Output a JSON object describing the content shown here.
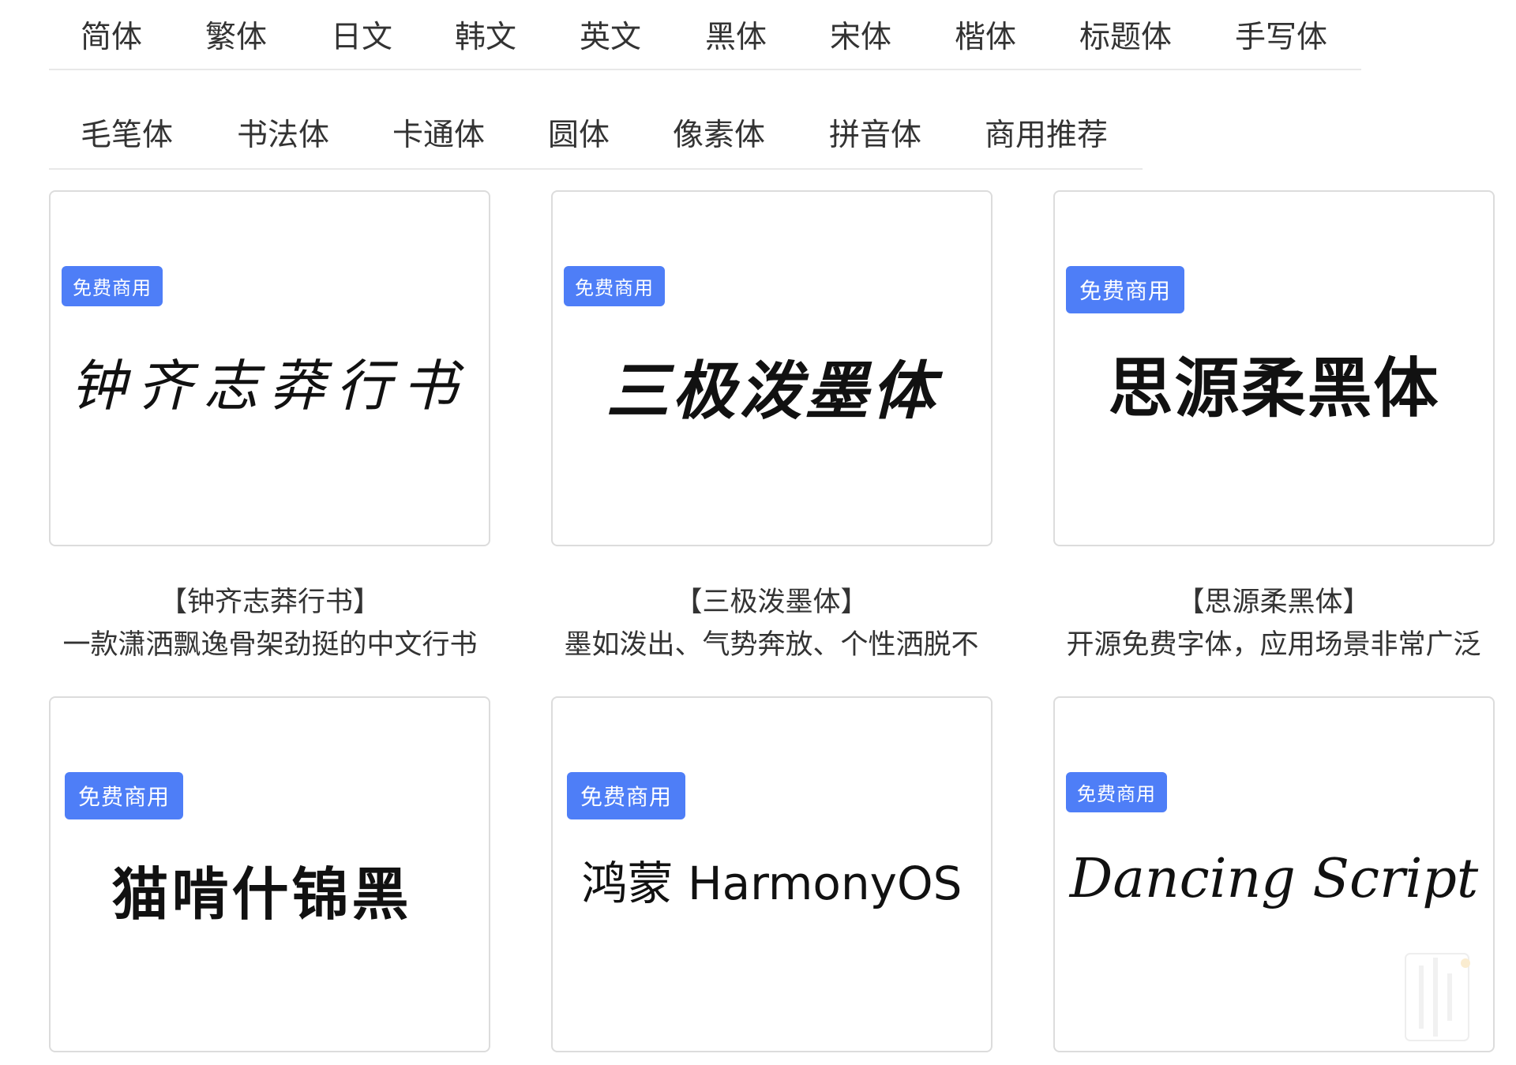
{
  "nav": {
    "row1": [
      "简体",
      "繁体",
      "日文",
      "韩文",
      "英文",
      "黑体",
      "宋体",
      "楷体",
      "标题体",
      "手写体"
    ],
    "row2": [
      "毛笔体",
      "书法体",
      "卡通体",
      "圆体",
      "像素体",
      "拼音体",
      "商用推荐"
    ]
  },
  "cards": [
    {
      "badge": "免费商用",
      "preview": "钟齐志莽行书",
      "title": "【钟齐志莽行书】",
      "description": "一款潇洒飘逸骨架劲挺的中文行书"
    },
    {
      "badge": "免费商用",
      "preview": "三极泼墨体",
      "title": "【三极泼墨体】",
      "description": "墨如泼出、气势奔放、个性洒脱不"
    },
    {
      "badge": "免费商用",
      "preview": "思源柔黑体",
      "title": "【思源柔黑体】",
      "description": "开源免费字体，应用场景非常广泛"
    },
    {
      "badge": "免费商用",
      "preview": "猫啃什锦黑"
    },
    {
      "badge": "免费商用",
      "preview": "鸿蒙 HarmonyOS"
    },
    {
      "badge": "免费商用",
      "preview": "Dancing Script"
    }
  ],
  "colors": {
    "badge_bg": "#4e7ef7",
    "divider": "#e8e8e8",
    "card_border": "#dcdcdc"
  }
}
